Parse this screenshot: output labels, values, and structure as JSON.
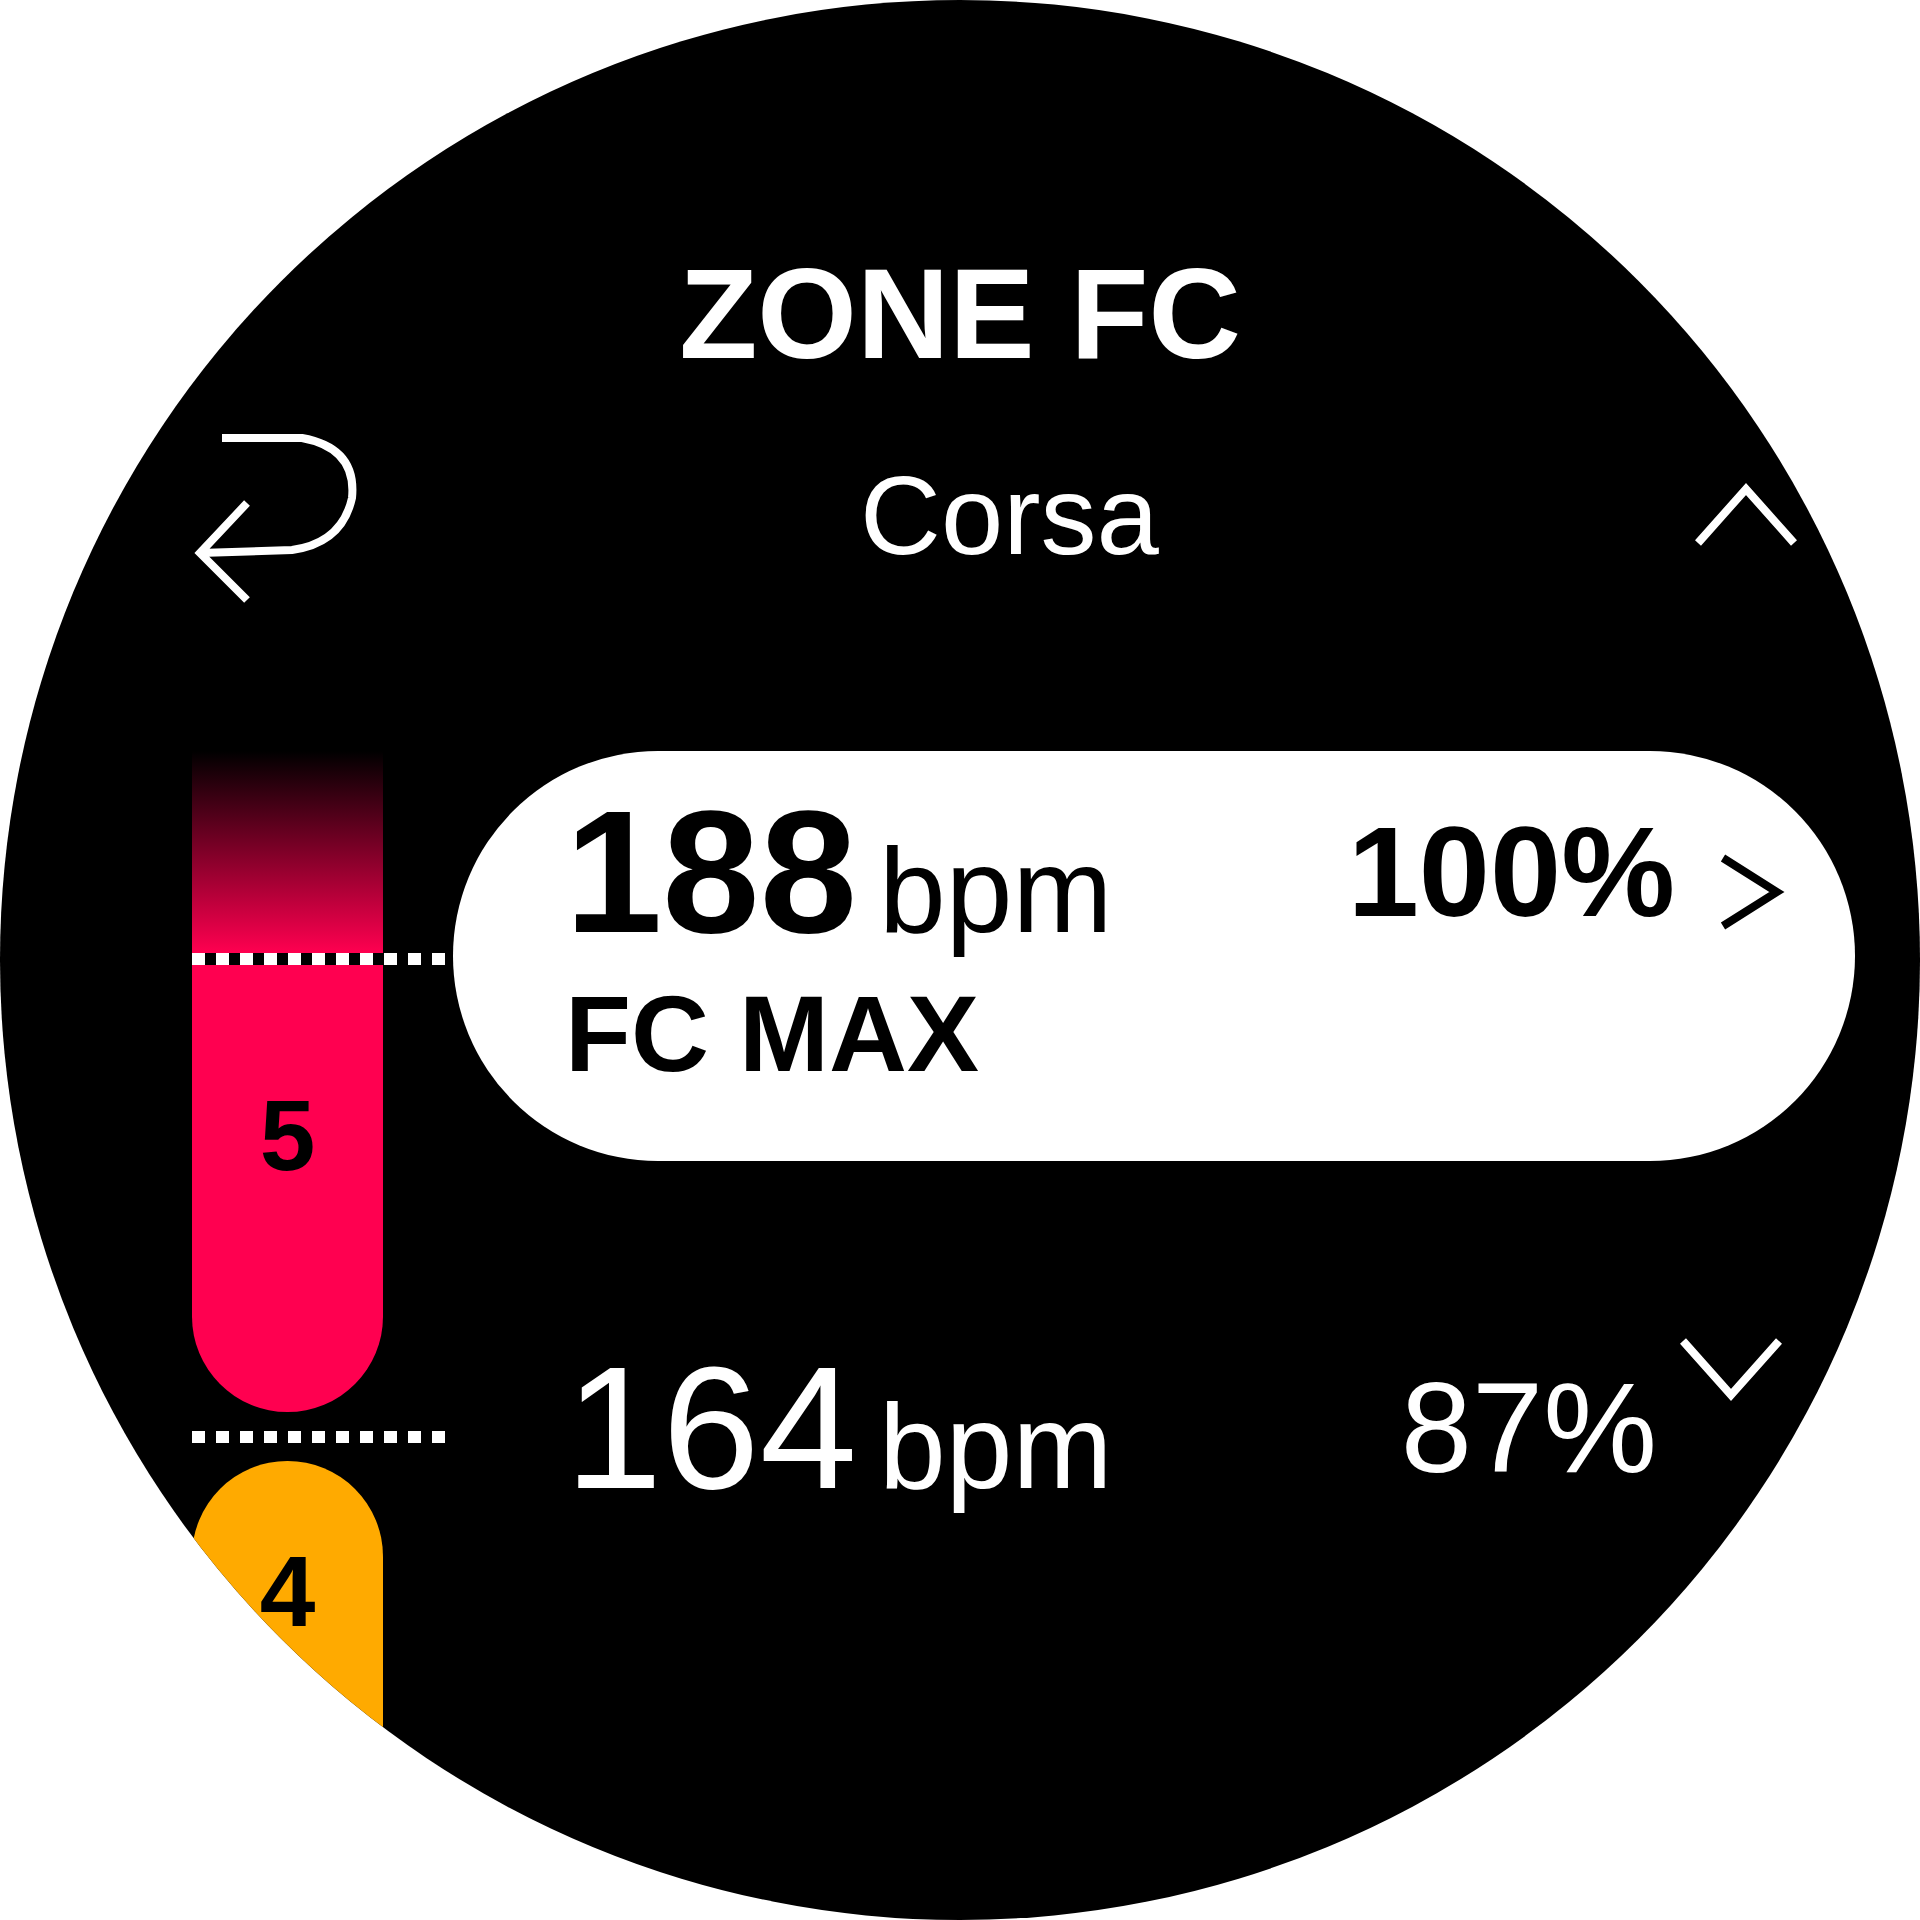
{
  "title": "ZONE FC",
  "subtitle": "Corsa",
  "zones": [
    {
      "label": "5",
      "color": "#ff0050",
      "selected": true
    },
    {
      "label": "4",
      "color": "#ffaa00",
      "selected": false
    }
  ],
  "rows": [
    {
      "value": "188",
      "unit": "bpm",
      "percent": "100%",
      "label": "FC MAX",
      "selected": true
    },
    {
      "value": "164",
      "unit": "bpm",
      "percent": "87%",
      "selected": false
    }
  ]
}
